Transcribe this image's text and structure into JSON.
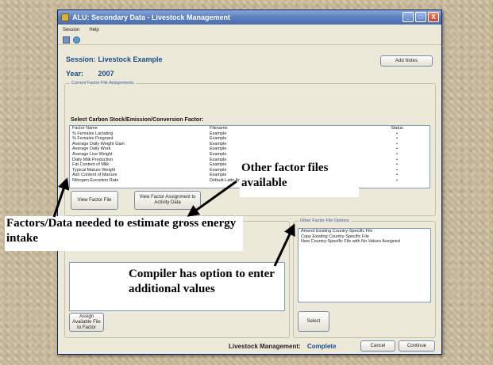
{
  "window": {
    "title": "ALU: Secondary Data - Livestock Management",
    "buttons": [
      "_",
      "□",
      "X"
    ]
  },
  "menu": [
    "Session",
    "Help"
  ],
  "toolbar_icons": [
    "save-icon",
    "help-icon"
  ],
  "session": {
    "label": "Session:",
    "value": "Livestock Example"
  },
  "year": {
    "label": "Year:",
    "value": "2007"
  },
  "add_notes_label": "Add Notes",
  "current_group_label": "Current Factor File Assignments",
  "select_heading": "Select Carbon Stock/Emission/Conversion Factor:",
  "factor_table": {
    "headers": [
      "Factor Name",
      "Filename",
      "Status"
    ],
    "rows": [
      [
        "% Females Lactating",
        "Example",
        "•"
      ],
      [
        "% Females Pregnant",
        "Example",
        "•"
      ],
      [
        "Average Daily Weight Gain",
        "Example",
        "•"
      ],
      [
        "Average Daily Work",
        "Example",
        "•"
      ],
      [
        "Average Live Weight",
        "Example",
        "•"
      ],
      [
        "Daily Milk Production",
        "Example",
        "•"
      ],
      [
        "Fat Content of Milk",
        "Example",
        "•"
      ],
      [
        "Typical Mature Weight",
        "Example",
        "•"
      ],
      [
        "Ash Content of Manure",
        "Example",
        "•"
      ],
      [
        "Nitrogen Excretion Rate",
        "Default-Latin America",
        "•"
      ]
    ]
  },
  "view_factor_file_label": "View Factor File",
  "view_assignment_label": "View Factor Assignment to Activity Data",
  "other_options_label": "Other Factor File Options",
  "other_options": [
    "Amend Existing Country-Specific File",
    "Copy Existing Country-Specific File",
    "New Country-Specific File with No Values Assigned"
  ],
  "assign_label": "Assign Available File to Factor",
  "select_label": "Select",
  "status": {
    "label": "Livestock Management:",
    "value": "Complete"
  },
  "cancel_label": "Cancel",
  "continue_label": "Continue",
  "annotations": {
    "other_files": "Other factor files available",
    "factors_needed": "Factors/Data needed to estimate gross energy intake",
    "compiler": "Compiler has option to enter additional values"
  }
}
